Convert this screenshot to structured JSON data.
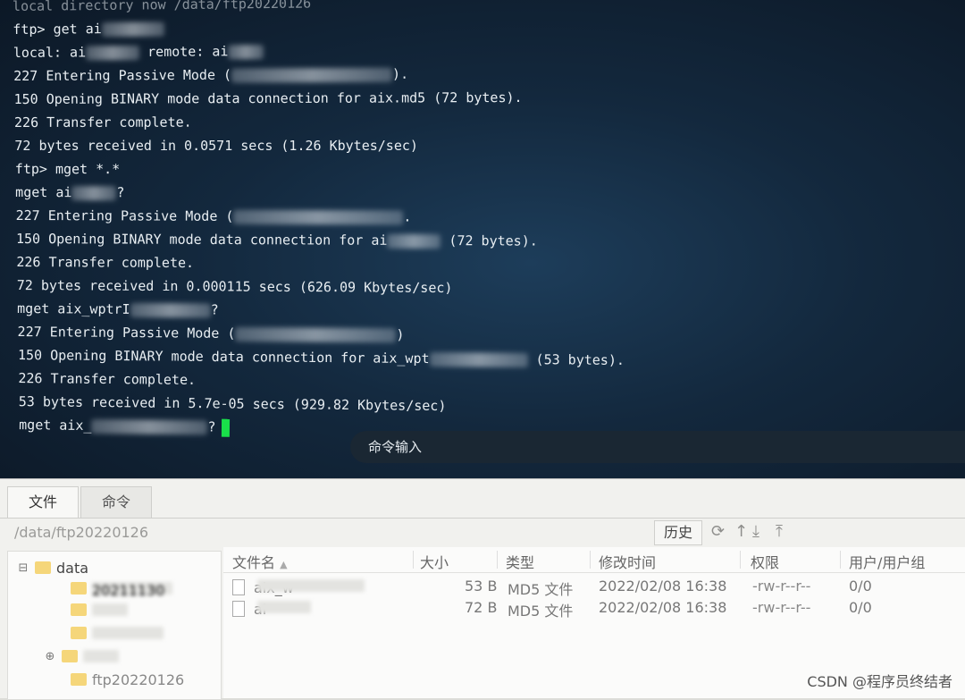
{
  "terminal": {
    "lines": [
      {
        "text": "local directory now /data/ftp20220126",
        "blur": 0
      },
      {
        "text": "ftp> get ai",
        "blur": 70
      },
      {
        "text": "local: ai",
        "blur": 60,
        "after": " remote: ai",
        "blur2": 40
      },
      {
        "text": "227 Entering Passive Mode (",
        "blur": 180,
        "after": ")."
      },
      {
        "text": "150 Opening BINARY mode data connection for aix.md5 (72 bytes).",
        "blur": 0
      },
      {
        "text": "226 Transfer complete.",
        "blur": 0
      },
      {
        "text": "72 bytes received in 0.0571 secs (1.26 Kbytes/sec)",
        "blur": 0
      },
      {
        "text": "ftp> mget *.*",
        "blur": 0
      },
      {
        "text": "mget ai",
        "blur": 50,
        "after": "?"
      },
      {
        "text": "227 Entering Passive Mode (",
        "blur": 190,
        "after": "."
      },
      {
        "text": "150 Opening BINARY mode data connection for ai",
        "blur": 60,
        "after": " (72 bytes)."
      },
      {
        "text": "226 Transfer complete.",
        "blur": 0
      },
      {
        "text": "72 bytes received in 0.000115 secs (626.09 Kbytes/sec)",
        "blur": 0
      },
      {
        "text": "mget aix_wptrI",
        "blur": 90,
        "after": "?"
      },
      {
        "text": "227 Entering Passive Mode (",
        "blur": 180,
        "after": ")"
      },
      {
        "text": "150 Opening BINARY mode data connection for aix_wpt",
        "blur": 110,
        "after": " (53 bytes)."
      },
      {
        "text": "226 Transfer complete.",
        "blur": 0
      },
      {
        "text": "53 bytes received in 5.7e-05 secs (929.82 Kbytes/sec)",
        "blur": 0
      },
      {
        "text": "mget aix_",
        "blur": 130,
        "after": "?",
        "cursor": true
      }
    ],
    "command_input_label": "命令输入"
  },
  "file_manager": {
    "tabs": [
      {
        "label": "文件",
        "active": true
      },
      {
        "label": "命令",
        "active": false
      }
    ],
    "path": "/data/ftp20220126",
    "history_label": "历史",
    "tree": {
      "root_label": "data",
      "items": [
        {
          "label": "20211130"
        },
        {
          "label": ""
        },
        {
          "label": ""
        },
        {
          "label": ""
        },
        {
          "label": "ftp20220126"
        }
      ]
    },
    "columns": [
      "文件名",
      "大小",
      "类型",
      "修改时间",
      "权限",
      "用户/用户组"
    ],
    "rows": [
      {
        "name": "aix_w",
        "size": "53 B",
        "type": "MD5 文件",
        "modified": "2022/02/08 16:38",
        "perm": "-rw-r--r--",
        "owner": "0/0"
      },
      {
        "name": "ai",
        "size": "72 B",
        "type": "MD5 文件",
        "modified": "2022/02/08 16:38",
        "perm": "-rw-r--r--",
        "owner": "0/0"
      }
    ]
  },
  "watermark": "CSDN @程序员终结者"
}
